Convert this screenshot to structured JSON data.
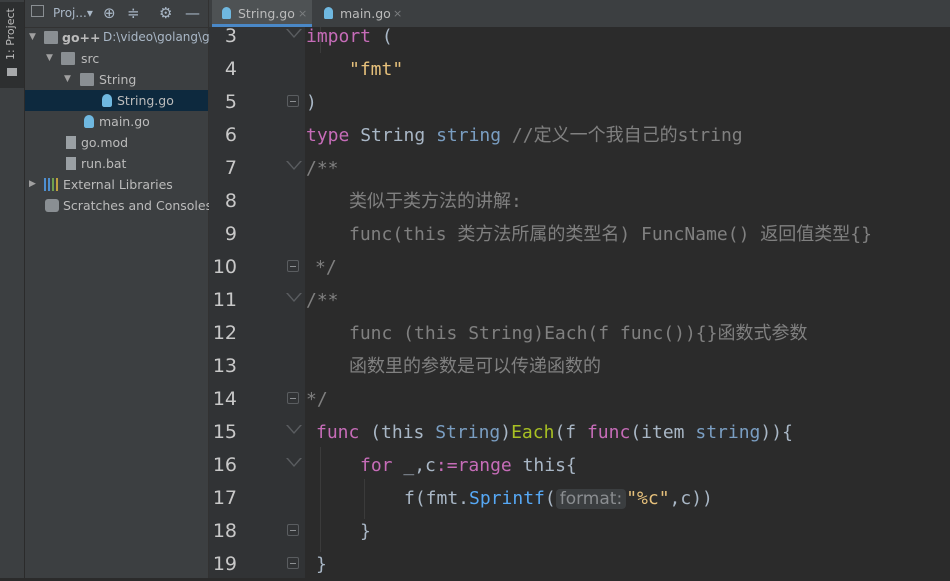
{
  "left_strip": {
    "label": "1: Project"
  },
  "project_panel": {
    "toolbar": {
      "title": "Proj...",
      "dropdown": "▾"
    },
    "tree": [
      {
        "label": "go++",
        "path": "D:\\video\\golang\\g",
        "kind": "folder",
        "expanded": true
      },
      {
        "label": "src",
        "kind": "folder",
        "expanded": true
      },
      {
        "label": "String",
        "kind": "folder",
        "expanded": true
      },
      {
        "label": "String.go",
        "kind": "gofile",
        "selected": true
      },
      {
        "label": "main.go",
        "kind": "gofile"
      },
      {
        "label": "go.mod",
        "kind": "modfile"
      },
      {
        "label": "run.bat",
        "kind": "modfile"
      },
      {
        "label": "External Libraries",
        "kind": "library",
        "expanded": false
      },
      {
        "label": "Scratches and Consoles",
        "kind": "scratch"
      }
    ]
  },
  "tabs": [
    {
      "label": "String.go",
      "active": true,
      "close": "×"
    },
    {
      "label": "main.go",
      "active": false,
      "close": "×"
    }
  ],
  "editor": {
    "line_numbers": [
      "3",
      "4",
      "5",
      "6",
      "7",
      "8",
      "9",
      "10",
      "11",
      "12",
      "13",
      "14",
      "15",
      "16",
      "17",
      "18",
      "19"
    ],
    "lines": {
      "l3": {
        "kw": "import",
        "rest": " ("
      },
      "l4": {
        "str": "\"fmt\""
      },
      "l5": {
        "text": ")"
      },
      "l6": {
        "kw": "type",
        "name": " String ",
        "type": "string",
        "comment": " //定义一个我自己的string"
      },
      "l7": {
        "comment": "/**"
      },
      "l8": {
        "comment": "类似于类方法的讲解:"
      },
      "l9": {
        "comment": "func(this 类方法所属的类型名) FuncName() 返回值类型{}"
      },
      "l10": {
        "comment": "*/"
      },
      "l11": {
        "comment": "/**"
      },
      "l12": {
        "comment": "func (this String)Each(f func()){}函数式参数"
      },
      "l13": {
        "comment": "函数里的参数是可以传递函数的"
      },
      "l14": {
        "comment": "*/"
      },
      "l15": {
        "kw": "func",
        "p1": " (this ",
        "type": "String",
        "p2": ")",
        "fn": "Each",
        "p3": "(f ",
        "kw2": "func",
        "p4": "(item ",
        "type2": "string",
        "p5": ")){"
      },
      "l16": {
        "kw": "for",
        "p1": " _,c",
        "op": ":=",
        "kw2": "range",
        "p2": " this{"
      },
      "l17": {
        "p1": "f(fmt.",
        "call": "Sprintf",
        "p2": "(",
        "hint": "format:",
        "str": "\"%c\"",
        "p3": ",c))"
      },
      "l18": {
        "text": "}"
      },
      "l19": {
        "text": "}"
      }
    }
  }
}
